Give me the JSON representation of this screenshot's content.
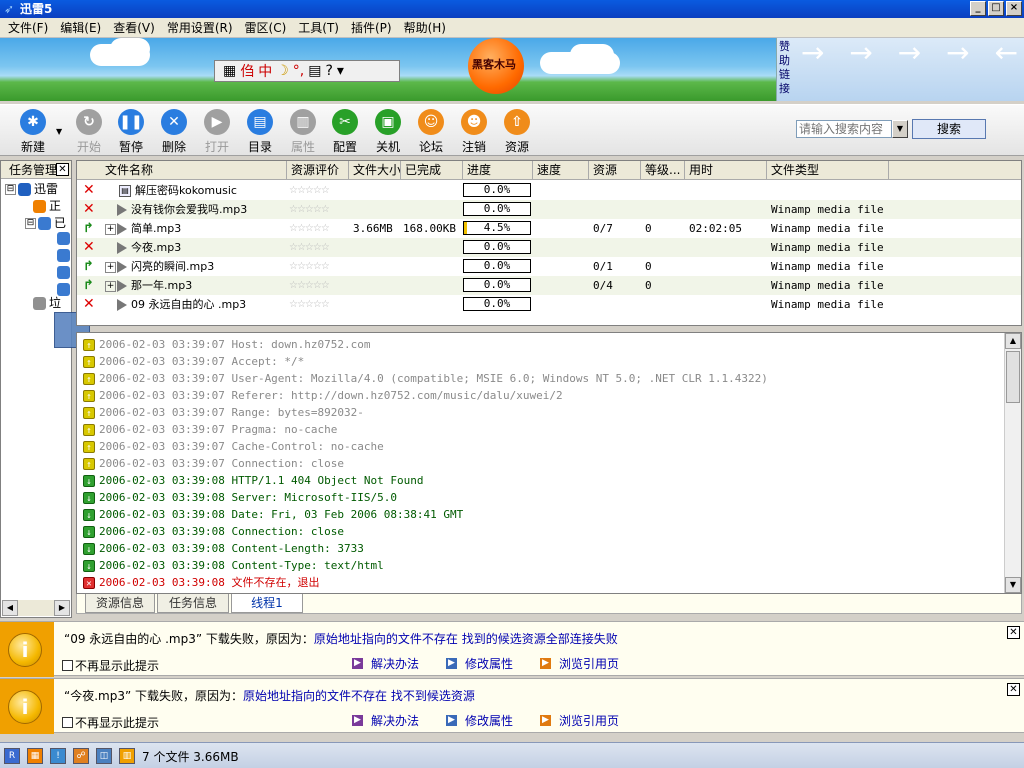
{
  "window": {
    "title": "迅雷5",
    "controls": [
      "_",
      "□",
      "×"
    ]
  },
  "menu": [
    "文件(F)",
    "编辑(E)",
    "查看(V)",
    "常用设置(R)",
    "雷区(C)",
    "工具(T)",
    "插件(P)",
    "帮助(H)"
  ],
  "banner": {
    "toolbar_glyphs": [
      "▦",
      "㑇",
      "中",
      "☽",
      "°,",
      "▤",
      "?",
      "▾"
    ],
    "balloon_text": "黑客木马",
    "sponsor_label": "赞助链接",
    "sponsor_arrows": "→ → → → ← ← ← ←"
  },
  "toolbar": {
    "buttons": [
      {
        "label": "新建",
        "icon": "new-icon",
        "color": "#2a7de0",
        "glyph": "✱",
        "enabled": true
      },
      {
        "label": "开始",
        "icon": "start-icon",
        "color": "#a0a0a0",
        "glyph": "↻",
        "enabled": false
      },
      {
        "label": "暂停",
        "icon": "pause-icon",
        "color": "#2a7de0",
        "glyph": "❚❚",
        "enabled": true
      },
      {
        "label": "删除",
        "icon": "delete-icon",
        "color": "#2a7de0",
        "glyph": "✕",
        "enabled": true
      },
      {
        "label": "打开",
        "icon": "open-icon",
        "color": "#a0a0a0",
        "glyph": "▶",
        "enabled": false
      },
      {
        "label": "目录",
        "icon": "folder-icon",
        "color": "#2a7de0",
        "glyph": "▤",
        "enabled": true
      },
      {
        "label": "属性",
        "icon": "properties-icon",
        "color": "#a0a0a0",
        "glyph": "▥",
        "enabled": false
      },
      {
        "label": "配置",
        "icon": "config-icon",
        "color": "#28a028",
        "glyph": "✂",
        "enabled": true
      },
      {
        "label": "关机",
        "icon": "shutdown-icon",
        "color": "#28a028",
        "glyph": "▣",
        "enabled": true
      },
      {
        "label": "论坛",
        "icon": "forum-icon",
        "color": "#f08c1a",
        "glyph": "☺",
        "enabled": true
      },
      {
        "label": "注销",
        "icon": "logout-icon",
        "color": "#f08c1a",
        "glyph": "☻",
        "enabled": true
      },
      {
        "label": "资源",
        "icon": "resource-icon",
        "color": "#f08c1a",
        "glyph": "⇧",
        "enabled": true
      }
    ],
    "search_placeholder": "请输入搜索内容",
    "search_button": "搜索"
  },
  "left_panel": {
    "title": "任务管理",
    "tree": [
      {
        "node": "⊟",
        "label": "迅雷",
        "folder_color": "#2060c0"
      },
      {
        "node": "",
        "label": "正",
        "folder_color": "#f08000"
      },
      {
        "node": "⊟",
        "label": "已",
        "folder_color": "#3a7ad0"
      },
      {
        "node": "",
        "label": "",
        "folder_color": "#3a7ad0"
      },
      {
        "node": "",
        "label": "",
        "folder_color": "#3a7ad0"
      },
      {
        "node": "",
        "label": "",
        "folder_color": "#3a7ad0"
      },
      {
        "node": "",
        "label": "",
        "folder_color": "#3a7ad0"
      },
      {
        "node": "",
        "label": "垃",
        "folder_color": "#909090"
      }
    ]
  },
  "file_list": {
    "columns": [
      "文件名称",
      "资源评价",
      "文件大小",
      "已完成",
      "进度",
      "速度",
      "资源",
      "等级...",
      "用时",
      "文件类型"
    ],
    "rows": [
      {
        "status": "✕",
        "status_type": "x",
        "expandable": false,
        "icon": "file",
        "name": "解压密码kokomusic",
        "rating": "☆☆☆☆☆",
        "size": "",
        "done": "",
        "progress_text": "0.0%",
        "progress": 0,
        "speed": "",
        "sources": "",
        "level": "",
        "time": "",
        "type": ""
      },
      {
        "status": "✕",
        "status_type": "x",
        "expandable": false,
        "icon": "play",
        "name": "没有钱你会爱我吗.mp3",
        "rating": "☆☆☆☆☆",
        "size": "",
        "done": "",
        "progress_text": "0.0%",
        "progress": 0,
        "speed": "",
        "sources": "",
        "level": "",
        "time": "",
        "type": "Winamp media file"
      },
      {
        "status": "↱",
        "status_type": "arrow",
        "expandable": true,
        "icon": "play",
        "name": "简单.mp3",
        "rating": "☆☆☆☆☆",
        "size": "3.66MB",
        "done": "168.00KB",
        "progress_text": "4.5%",
        "progress": 0.045,
        "speed": "",
        "sources": "0/7",
        "level": "0",
        "time": "02:02:05",
        "type": "Winamp media file"
      },
      {
        "status": "✕",
        "status_type": "x",
        "expandable": false,
        "icon": "play",
        "name": "今夜.mp3",
        "rating": "☆☆☆☆☆",
        "size": "",
        "done": "",
        "progress_text": "0.0%",
        "progress": 0,
        "speed": "",
        "sources": "",
        "level": "",
        "time": "",
        "type": "Winamp media file"
      },
      {
        "status": "↱",
        "status_type": "arrow",
        "expandable": true,
        "icon": "play",
        "name": "闪亮的瞬间.mp3",
        "rating": "☆☆☆☆☆",
        "size": "",
        "done": "",
        "progress_text": "0.0%",
        "progress": 0,
        "speed": "",
        "sources": "0/1",
        "level": "0",
        "time": "",
        "type": "Winamp media file"
      },
      {
        "status": "↱",
        "status_type": "arrow",
        "expandable": true,
        "icon": "play",
        "name": "那一年.mp3",
        "rating": "☆☆☆☆☆",
        "size": "",
        "done": "",
        "progress_text": "0.0%",
        "progress": 0,
        "speed": "",
        "sources": "0/4",
        "level": "0",
        "time": "",
        "type": "Winamp media file"
      },
      {
        "status": "✕",
        "status_type": "x",
        "expandable": false,
        "icon": "play",
        "name": "09 永远自由的心 .mp3",
        "rating": "☆☆☆☆☆",
        "size": "",
        "done": "",
        "progress_text": "0.0%",
        "progress": 0,
        "speed": "",
        "sources": "",
        "level": "",
        "time": "",
        "type": "Winamp media file"
      }
    ]
  },
  "log": [
    {
      "type": "up",
      "text": "2006-02-03 03:39:07 Host: down.hz0752.com"
    },
    {
      "type": "up",
      "text": "2006-02-03 03:39:07 Accept: */*"
    },
    {
      "type": "up",
      "text": "2006-02-03 03:39:07 User-Agent: Mozilla/4.0 (compatible; MSIE 6.0; Windows NT 5.0; .NET CLR 1.1.4322)"
    },
    {
      "type": "up",
      "text": "2006-02-03 03:39:07 Referer: http://down.hz0752.com/music/dalu/xuwei/2"
    },
    {
      "type": "up",
      "text": "2006-02-03 03:39:07 Range: bytes=892032-"
    },
    {
      "type": "up",
      "text": "2006-02-03 03:39:07 Pragma: no-cache"
    },
    {
      "type": "up",
      "text": "2006-02-03 03:39:07 Cache-Control: no-cache"
    },
    {
      "type": "up",
      "text": "2006-02-03 03:39:07 Connection: close"
    },
    {
      "type": "down",
      "text": "2006-02-03 03:39:08 HTTP/1.1 404 Object Not Found"
    },
    {
      "type": "down",
      "text": "2006-02-03 03:39:08 Server: Microsoft-IIS/5.0"
    },
    {
      "type": "down",
      "text": "2006-02-03 03:39:08 Date: Fri, 03 Feb 2006 08:38:41 GMT"
    },
    {
      "type": "down",
      "text": "2006-02-03 03:39:08 Connection: close"
    },
    {
      "type": "down",
      "text": "2006-02-03 03:39:08 Content-Length: 3733"
    },
    {
      "type": "down",
      "text": "2006-02-03 03:39:08 Content-Type: text/html"
    },
    {
      "type": "x",
      "text": "2006-02-03 03:39:08 文件不存在，退出"
    }
  ],
  "tabs": [
    {
      "label": "资源信息",
      "active": false
    },
    {
      "label": "任务信息",
      "active": false
    },
    {
      "label": "线程1",
      "active": true
    }
  ],
  "notices": [
    {
      "prefix": "“09 永远自由的心 .mp3” 下载失败，原因为：",
      "reason": "原始地址指向的文件不存在  找到的候选资源全部连接失败",
      "dont_show": "不再显示此提示",
      "links": [
        "解决办法",
        "修改属性",
        "浏览引用页"
      ]
    },
    {
      "prefix": "“今夜.mp3” 下载失败，原因为：",
      "reason": "原始地址指向的文件不存在  找不到候选资源",
      "dont_show": "不再显示此提示",
      "links": [
        "解决办法",
        "修改属性",
        "浏览引用页"
      ]
    }
  ],
  "statusbar": {
    "icons": [
      "R",
      "▦",
      "!",
      "☍",
      "◫",
      "▥"
    ],
    "text": "7 个文件 3.66MB"
  }
}
